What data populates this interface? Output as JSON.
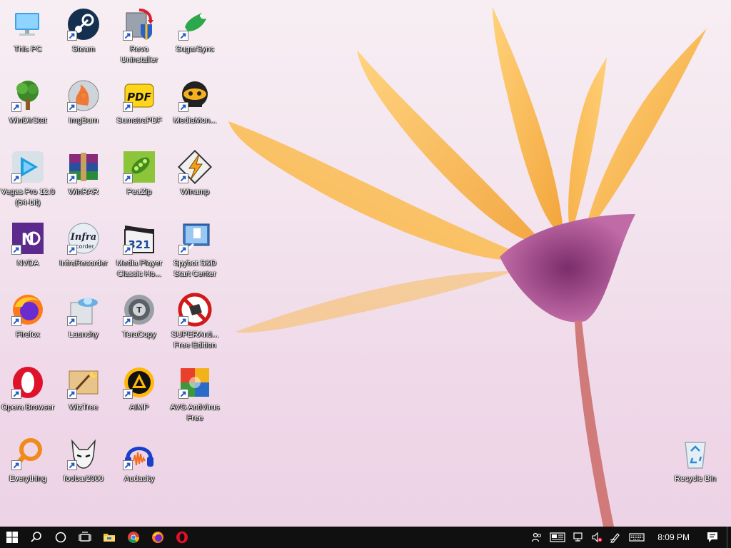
{
  "desktop": {
    "icons": [
      {
        "label": "This PC",
        "icon": "computer-icon"
      },
      {
        "label": "Steam",
        "icon": "steam-icon"
      },
      {
        "label": "Revo Uninstaller",
        "icon": "revo-uninstaller-icon"
      },
      {
        "label": "SugarSync",
        "icon": "sugarsync-icon"
      },
      {
        "label": "WinDirStat",
        "icon": "windirstat-icon"
      },
      {
        "label": "ImgBurn",
        "icon": "imgburn-icon"
      },
      {
        "label": "SumatraPDF",
        "icon": "sumatrapdf-icon"
      },
      {
        "label": "MediaMon...",
        "icon": "mediamonkey-icon"
      },
      {
        "label": "Vegas Pro 12.0 (64-bit)",
        "icon": "vegas-pro-icon"
      },
      {
        "label": "WinRAR",
        "icon": "winrar-icon"
      },
      {
        "label": "PeaZip",
        "icon": "peazip-icon"
      },
      {
        "label": "Winamp",
        "icon": "winamp-icon"
      },
      {
        "label": "NVDA",
        "icon": "nvda-icon"
      },
      {
        "label": "InfraRecorder",
        "icon": "infrarecorder-icon"
      },
      {
        "label": "Media Player Classic Ho...",
        "icon": "media-player-classic-icon"
      },
      {
        "label": "Spybot S&D Start Center",
        "icon": "spybot-icon"
      },
      {
        "label": "Firefox",
        "icon": "firefox-icon"
      },
      {
        "label": "Launchy",
        "icon": "launchy-icon"
      },
      {
        "label": "TeraCopy",
        "icon": "teracopy-icon"
      },
      {
        "label": "SUPERAnti... Free Edition",
        "icon": "superantispyware-icon"
      },
      {
        "label": "Opera Browser",
        "icon": "opera-icon"
      },
      {
        "label": "WizTree",
        "icon": "wiztree-icon"
      },
      {
        "label": "AIMP",
        "icon": "aimp-icon"
      },
      {
        "label": "AVG AntiVirus Free",
        "icon": "avg-icon"
      },
      {
        "label": "Everything",
        "icon": "everything-icon"
      },
      {
        "label": "foobar2000",
        "icon": "foobar2000-icon"
      },
      {
        "label": "Audacity",
        "icon": "audacity-icon"
      },
      {
        "label": "Recycle Bin",
        "icon": "recycle-bin-icon"
      }
    ]
  },
  "taskbar": {
    "clock": "8:09 PM",
    "pinned": [
      "start-icon",
      "search-icon",
      "cortana-icon",
      "task-view-icon",
      "file-explorer-icon",
      "chrome-icon",
      "firefox-icon",
      "opera-icon"
    ],
    "tray": [
      "people-icon",
      "news-icon",
      "network-icon",
      "volume-muted-icon",
      "pen-icon",
      "keyboard-icon"
    ],
    "colors": {
      "background": "#101010",
      "text": "#ffffff"
    }
  }
}
